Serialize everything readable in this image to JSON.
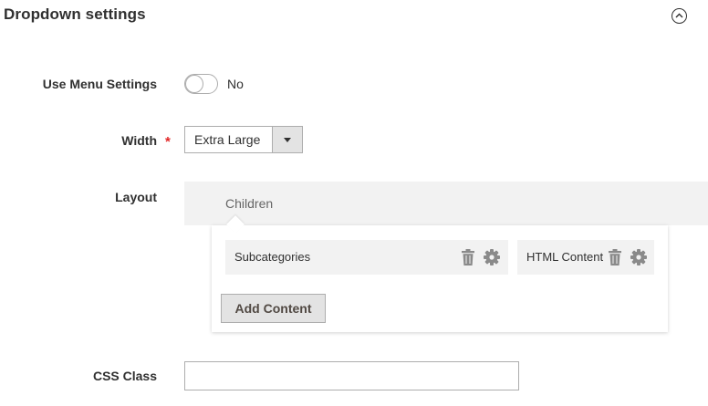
{
  "section": {
    "title": "Dropdown settings"
  },
  "fields": {
    "use_menu_settings": {
      "label": "Use Menu Settings",
      "value_text": "No",
      "enabled": false
    },
    "width": {
      "label": "Width",
      "required_mark": "*",
      "selected": "Extra Large"
    },
    "layout": {
      "label": "Layout",
      "header": "Children",
      "items": [
        {
          "label": "Subcategories"
        },
        {
          "label": "HTML Content"
        }
      ],
      "add_button": "Add Content"
    },
    "css_class": {
      "label": "CSS Class",
      "value": "",
      "placeholder": ""
    }
  },
  "icons": {
    "collapse": "chevron-up-circle-icon",
    "delete": "trash-icon",
    "settings": "gear-icon",
    "select_arrow": "caret-down-icon"
  },
  "colors": {
    "required": "#e22626",
    "panel_bg": "#f2f2f2",
    "button_bg": "#e3e3e3",
    "border": "#adadad",
    "icon": "#8a8a8a"
  }
}
